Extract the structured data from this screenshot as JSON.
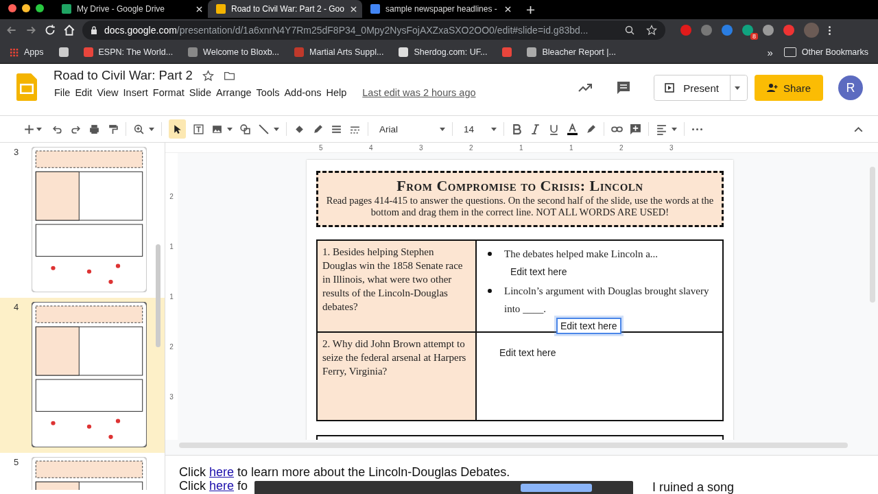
{
  "browser": {
    "tabs": [
      {
        "title": "My Drive - Google Drive",
        "selected": false,
        "kind": "drive"
      },
      {
        "title": "Road to Civil War: Part 2 - Goo",
        "selected": true,
        "kind": "slides"
      },
      {
        "title": "sample newspaper headlines -",
        "selected": false,
        "kind": "google"
      }
    ],
    "url": {
      "host": "docs.google.com",
      "path": "/presentation/d/1a6xnrN4Y7Rm25dF8P34_0Mpy2NysFojAXZxaSXO2OO0/edit#slide=id.g83bd..."
    },
    "bookmarks": [
      {
        "kind": "apps",
        "label": "Apps"
      },
      {
        "kind": "icon_only"
      },
      {
        "kind": "site",
        "label": "ESPN: The World..."
      },
      {
        "kind": "site",
        "label": "Welcome to Bloxb..."
      },
      {
        "kind": "site",
        "label": "Martial Arts Suppl..."
      },
      {
        "kind": "site",
        "label": "Sherdog.com: UF..."
      },
      {
        "kind": "icon_only"
      },
      {
        "kind": "site",
        "label": "Bleacher Report |..."
      }
    ],
    "other_bookmarks": "Other Bookmarks",
    "more": "»",
    "extension_badge": "8"
  },
  "docs": {
    "title": "Road to Civil War: Part 2",
    "menus": [
      "File",
      "Edit",
      "View",
      "Insert",
      "Format",
      "Slide",
      "Arrange",
      "Tools",
      "Add-ons",
      "Help"
    ],
    "last_edit": "Last edit was 2 hours ago",
    "present": "Present",
    "share": "Share",
    "avatar": "R"
  },
  "toolbar": {
    "font": "Arial",
    "size": "14"
  },
  "ruler": {
    "horizontal": [
      "5",
      "4",
      "3",
      "2",
      "1",
      "1",
      "2",
      "3"
    ],
    "vertical": [
      "2",
      "1",
      "1",
      "2",
      "3"
    ]
  },
  "filmstrip": [
    {
      "number": "3",
      "selected": false
    },
    {
      "number": "4",
      "selected": true
    },
    {
      "number": "5",
      "selected": false
    }
  ],
  "slide": {
    "title": "From Compromise to Crisis: Lincoln",
    "instructions": "Read pages 414-415 to answer the questions. On the second half of the slide, use the words at the bottom and drag them in the correct line. NOT ALL WORDS ARE USED!",
    "rows": [
      {
        "question": "1. Besides helping Stephen Douglas win the 1858 Senate race in Illinois, what were two other results of the Lincoln-Douglas debates?",
        "answers": [
          {
            "kind": "bullet",
            "text": "The debates helped make Lincoln a..."
          },
          {
            "kind": "textbox",
            "text": "Edit text here",
            "selected": false
          },
          {
            "kind": "bullet",
            "text": "Lincoln’s argument with Douglas brought slavery into",
            "blank": "____."
          },
          {
            "kind": "textbox",
            "text": "Edit text here",
            "selected": true
          }
        ]
      },
      {
        "question": "2. Why did John Brown attempt to seize the federal arsenal at Harpers Ferry, Virginia?",
        "answers": [
          {
            "kind": "textbox",
            "text": "Edit text here",
            "selected": false
          }
        ]
      }
    ]
  },
  "notes": [
    {
      "before": "Click ",
      "link": "here",
      "after": " to learn more about the Lincoln-Douglas Debates."
    },
    {
      "before": "Click ",
      "link": "here",
      "after": " fo"
    }
  ],
  "notes_tail": "I ruined a song"
}
